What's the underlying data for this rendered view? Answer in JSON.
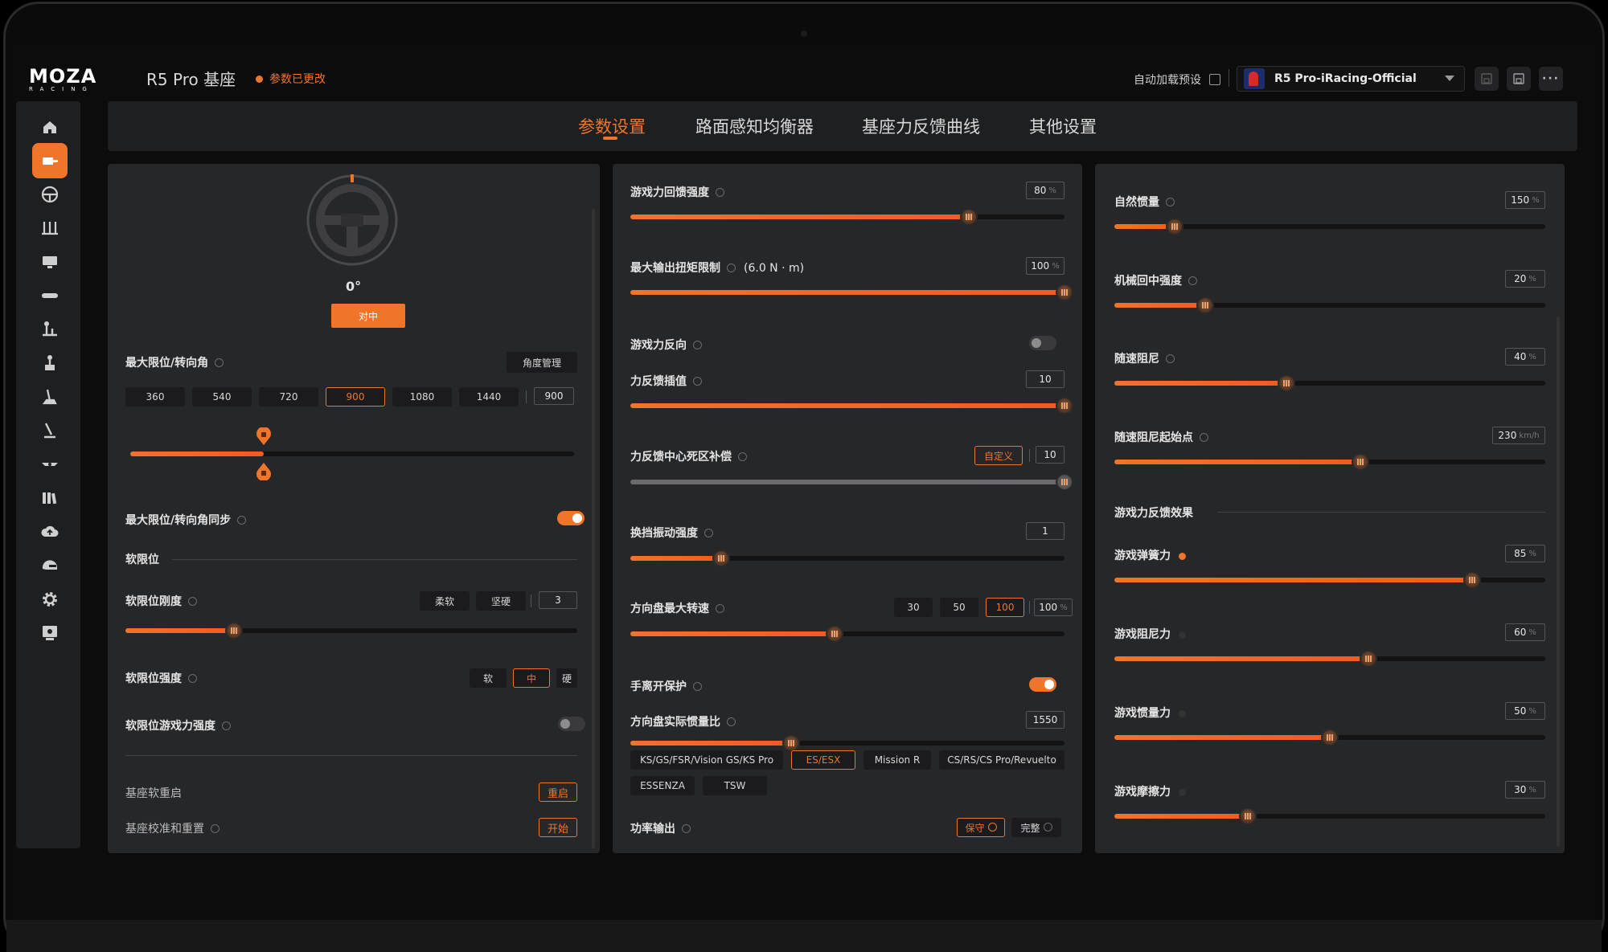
{
  "header": {
    "logo_main": "MOZA",
    "logo_sub": "RACING",
    "device_title": "R5 Pro 基座",
    "changed_label": "参数已更改",
    "autoload_label": "自动加载预设",
    "preset_name": "R5 Pro-iRacing-Official"
  },
  "tabs": [
    "参数设置",
    "路面感知均衡器",
    "基座力反馈曲线",
    "其他设置"
  ],
  "left_panel": {
    "angle_display": "0°",
    "center_button": "对中",
    "max_angle_label": "最大限位/转向角",
    "angle_manage_button": "角度管理",
    "angle_presets": [
      "360",
      "540",
      "720",
      "900",
      "1080",
      "1440"
    ],
    "angle_selected": "900",
    "angle_value": "900",
    "angle_slider_fraction": 0.3,
    "sync_label": "最大限位/转向角同步",
    "soft_limit_section": "软限位",
    "soft_stiffness_label": "软限位刚度",
    "soft_stiffness_options": [
      "柔软",
      "坚硬"
    ],
    "soft_stiffness_value": "3",
    "soft_stiffness_fraction": 0.24,
    "soft_strength_label": "软限位强度",
    "soft_strength_options": [
      "软",
      "中",
      "硬"
    ],
    "soft_strength_selected": "中",
    "soft_game_label": "软限位游戏力强度",
    "reboot_label": "基座软重启",
    "reboot_button": "重启",
    "calibrate_label": "基座校准和重置",
    "calibrate_button": "开始"
  },
  "middle_panel": {
    "ffb_strength_label": "游戏力回馈强度",
    "ffb_strength_value": "80",
    "ffb_strength_fraction": 0.78,
    "max_torque_label": "最大输出扭矩限制",
    "max_torque_note": "(6.0 N · m)",
    "max_torque_value": "100",
    "max_torque_fraction": 1.0,
    "reverse_label": "游戏力反向",
    "interp_label": "力反馈插值",
    "interp_value": "10",
    "interp_fraction": 1.0,
    "deadzone_label": "力反馈中心死区补偿",
    "deadzone_custom": "自定义",
    "deadzone_value": "10",
    "deadzone_fraction": 1.0,
    "shift_vib_label": "换挡振动强度",
    "shift_vib_value": "1",
    "shift_vib_fraction": 0.21,
    "max_speed_label": "方向盘最大转速",
    "max_speed_options": [
      "30",
      "50",
      "100"
    ],
    "max_speed_selected": "100",
    "max_speed_value": "100",
    "max_speed_fraction": 0.47,
    "hands_off_label": "手离开保护",
    "inertia_label": "方向盘实际惯量比",
    "inertia_value": "1550",
    "inertia_fraction": 0.37,
    "wheel_types": [
      "KS/GS/FSR/Vision GS/KS Pro",
      "ES/ESX",
      "Mission R",
      "CS/RS/CS Pro/Revuelto",
      "ESSENZA",
      "TSW"
    ],
    "wheel_selected": "ES/ESX",
    "power_label": "功率输出",
    "power_options": [
      "保守",
      "完整"
    ],
    "power_selected": "保守"
  },
  "right_panel": {
    "natural_inertia_label": "自然惯量",
    "natural_inertia_value": "150",
    "natural_inertia_fraction": 0.14,
    "mech_center_label": "机械回中强度",
    "mech_center_value": "20",
    "mech_center_fraction": 0.21,
    "speed_damp_label": "随速阻尼",
    "speed_damp_value": "40",
    "speed_damp_fraction": 0.4,
    "speed_damp_start_label": "随速阻尼起始点",
    "speed_damp_start_value": "230",
    "speed_damp_start_unit": "km/h",
    "speed_damp_start_fraction": 0.57,
    "game_effects_section": "游戏力反馈效果",
    "spring_label": "游戏弹簧力",
    "spring_value": "85",
    "spring_fraction": 0.83,
    "damper_label": "游戏阻尼力",
    "damper_value": "60",
    "damper_fraction": 0.59,
    "inertia_label": "游戏惯量力",
    "inertia_value": "50",
    "inertia_fraction": 0.5,
    "friction_label": "游戏摩擦力",
    "friction_value": "30",
    "friction_fraction": 0.31,
    "percent_unit": "%"
  },
  "colors": {
    "accent": "#f0742a",
    "panel": "#262729",
    "background": "#0c0c0d"
  }
}
